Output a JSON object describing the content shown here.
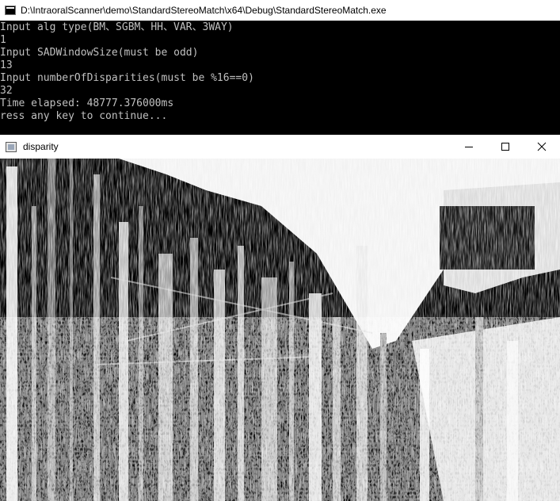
{
  "console": {
    "title": "D:\\IntraoralScanner\\demo\\StandardStereoMatch\\x64\\Debug\\StandardStereoMatch.exe",
    "lines": [
      "Input alg type(BM、SGBM、HH、VAR、3WAY)",
      "1",
      "Input SADWindowSize(must be odd)",
      "13",
      "Input numberOfDisparities(must be %16==0)",
      "32",
      "Time elapsed: 48777.376000ms",
      "ress any key to continue..."
    ]
  },
  "image_window": {
    "title": "disparity",
    "icons": {
      "app": "image-window-icon",
      "minimize": "minimize-icon",
      "maximize": "maximize-icon",
      "close": "close-icon"
    }
  },
  "colors": {
    "console_bg": "#000000",
    "console_text": "#c0c0c0",
    "titlebar_bg": "#ffffff"
  }
}
